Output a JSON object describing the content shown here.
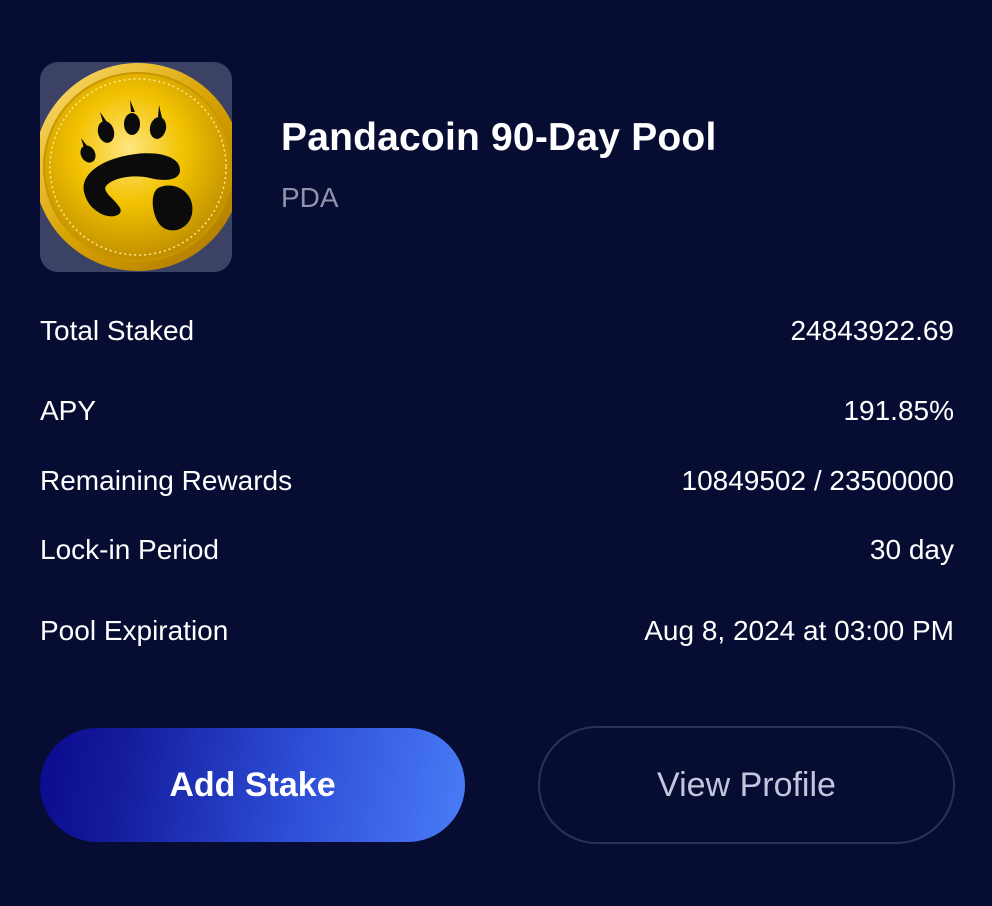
{
  "pool": {
    "name": "Pandacoin 90-Day Pool",
    "symbol": "PDA",
    "logo_icon": "paw-coin-icon"
  },
  "stats": [
    {
      "label": "Total Staked",
      "value": "24843922.69"
    },
    {
      "label": "APY",
      "value": "191.85%"
    },
    {
      "label": "Remaining Rewards",
      "value": "10849502 / 23500000"
    },
    {
      "label": "Lock-in Period",
      "value": "30 day"
    },
    {
      "label": "Pool Expiration",
      "value": "Aug 8, 2024 at 03:00 PM"
    }
  ],
  "actions": {
    "add_stake_label": "Add Stake",
    "view_profile_label": "View Profile"
  },
  "colors": {
    "background": "#070c33",
    "accent_start": "#0a0a8e",
    "accent_end": "#4a7cf7",
    "muted_text": "#8f93ab",
    "coin_gold": "#f2c200"
  }
}
